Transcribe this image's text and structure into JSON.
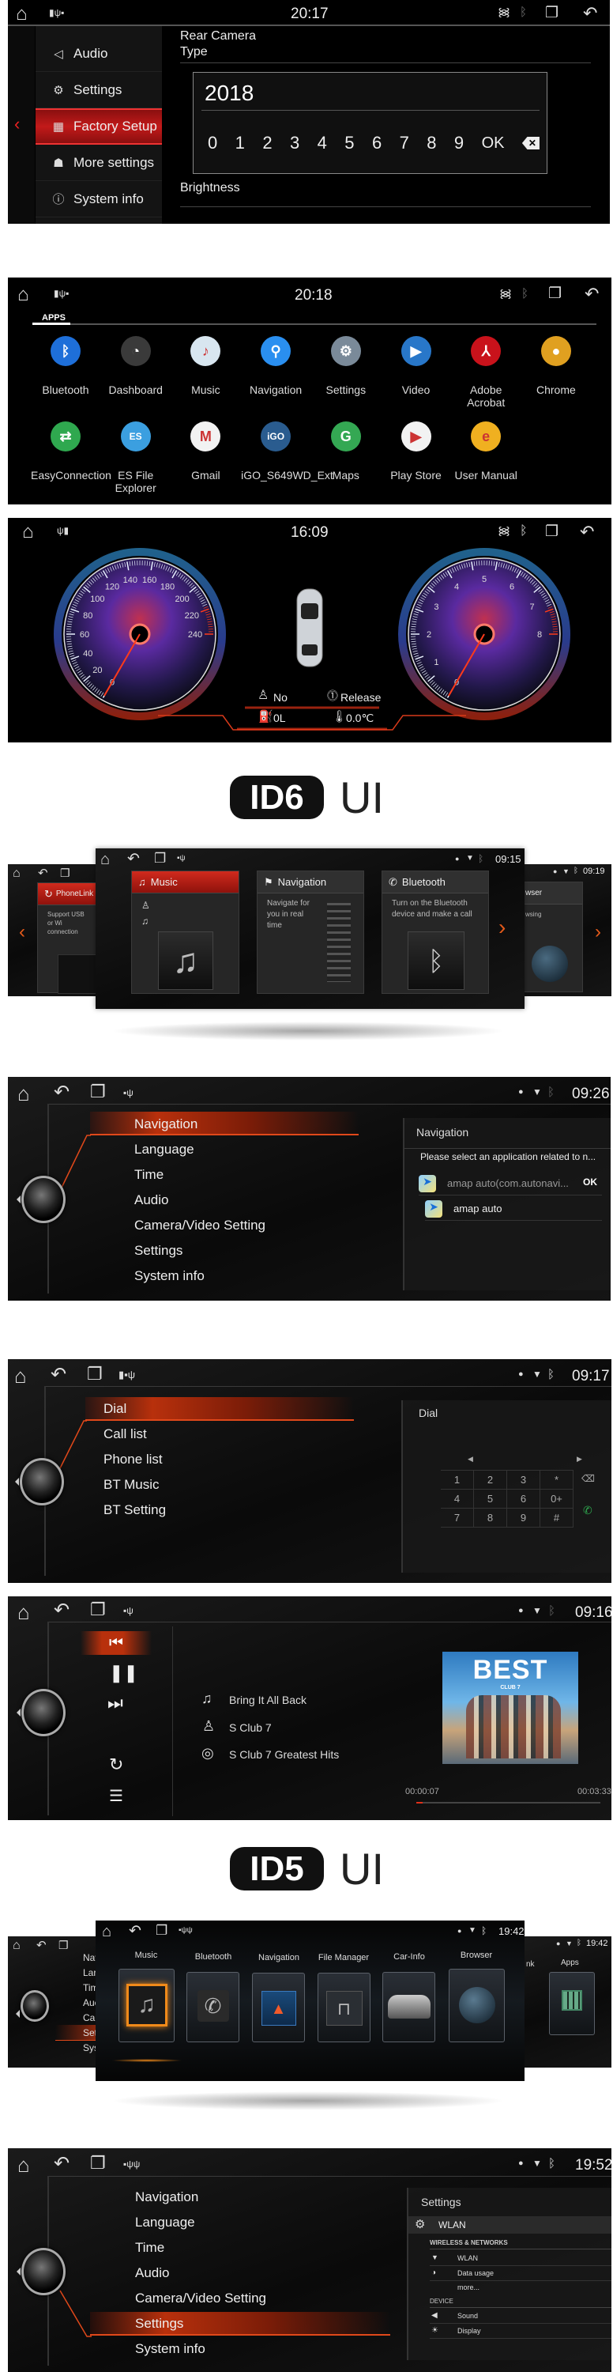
{
  "factory_setup": {
    "status": {
      "time": "20:17"
    },
    "menu": [
      {
        "label": "Audio",
        "icon": "speaker-icon"
      },
      {
        "label": "Settings",
        "icon": "gear-icon"
      },
      {
        "label": "Factory Setup",
        "icon": "factory-icon"
      },
      {
        "label": "More settings",
        "icon": "android-icon"
      },
      {
        "label": "System info",
        "icon": "info-icon"
      }
    ],
    "selected": "Factory Setup",
    "setting_title": "Rear Camera Type",
    "input_value": "2018",
    "keypad": [
      "0",
      "1",
      "2",
      "3",
      "4",
      "5",
      "6",
      "7",
      "8",
      "9",
      "OK"
    ],
    "brightness_label": "Brightness",
    "accent_color": "#c21a1a"
  },
  "apps_screen": {
    "status": {
      "time": "20:18"
    },
    "tab": "APPS",
    "apps": [
      {
        "label": "Bluetooth",
        "icon": "bluetooth-icon",
        "glyph": "ᛒ",
        "color": "#1e6fd9"
      },
      {
        "label": "Dashboard",
        "icon": "dashboard-icon",
        "glyph": "◔",
        "color": "#3a3a3a"
      },
      {
        "label": "Music",
        "icon": "music-icon",
        "glyph": "♪",
        "color": "#d8e6f0"
      },
      {
        "label": "Navigation",
        "icon": "location-pin-icon",
        "glyph": "⚲",
        "color": "#2a8ff0"
      },
      {
        "label": "Settings",
        "icon": "gear-icon",
        "glyph": "⚙",
        "color": "#7a8a99"
      },
      {
        "label": "Video",
        "icon": "clapperboard-icon",
        "glyph": "▶",
        "color": "#2877c9"
      },
      {
        "label": "Adobe Acrobat",
        "icon": "acrobat-icon",
        "glyph": "⅄",
        "color": "#c9121b"
      },
      {
        "label": "Chrome",
        "icon": "chrome-icon",
        "glyph": "●",
        "color": "#e0a020"
      },
      {
        "label": "EasyConnection",
        "icon": "easyconnection-icon",
        "glyph": "⇄",
        "color": "#2fa84f"
      },
      {
        "label": "ES File Explorer",
        "icon": "folder-icon",
        "glyph": "ES",
        "color": "#3b9fe0"
      },
      {
        "label": "Gmail",
        "icon": "gmail-icon",
        "glyph": "M",
        "color": "#f2f2f2"
      },
      {
        "label": "iGO_S649WD_Ext",
        "icon": "igo-icon",
        "glyph": "iGO",
        "color": "#2a5c8f"
      },
      {
        "label": "Maps",
        "icon": "maps-icon",
        "glyph": "G",
        "color": "#34a853"
      },
      {
        "label": "Play Store",
        "icon": "play-store-icon",
        "glyph": "▶",
        "color": "#f2f2f2"
      },
      {
        "label": "User Manual",
        "icon": "manual-icon",
        "glyph": "e",
        "color": "#f0b020"
      }
    ]
  },
  "dashboard": {
    "status": {
      "time": "16:09"
    },
    "speedometer": {
      "ticks": [
        0,
        20,
        40,
        60,
        80,
        100,
        120,
        140,
        160,
        180,
        200,
        220,
        240
      ],
      "value": 0
    },
    "tachometer": {
      "ticks": [
        0,
        1,
        2,
        3,
        4,
        5,
        6,
        7,
        8
      ],
      "value": 0
    },
    "seatbelt": "No",
    "handbrake": "Release",
    "fuel": "0L",
    "temperature": "0.0℃"
  },
  "id6_heading": {
    "badge": "ID6",
    "suffix": "UI"
  },
  "id6_carousel": {
    "front": {
      "time": "09:15",
      "cards": [
        {
          "title": "Music",
          "icon": "music-note-icon"
        },
        {
          "title": "Navigation",
          "icon": "checkered-flag-icon",
          "description": "Navigate for you in real time"
        },
        {
          "title": "Bluetooth",
          "icon": "phone-handset-icon",
          "description": "Turn on the Bluetooth device and make a call"
        }
      ]
    },
    "left": {
      "title": "PhoneLink",
      "description": "Support USB or Wi connection"
    },
    "right": {
      "time": "09:19",
      "title": "wser",
      "description": "wsing"
    }
  },
  "id6_settings": {
    "time": "09:26",
    "menu": [
      "Navigation",
      "Language",
      "Time",
      "Audio",
      "Camera/Video Setting",
      "Settings",
      "System info"
    ],
    "selected": "Navigation",
    "panel": {
      "title": "Navigation",
      "prompt": "Please select an application related to n...",
      "options": [
        {
          "label": "amap auto(com.autonavi...",
          "action": "OK"
        },
        {
          "label": "amap auto"
        }
      ]
    }
  },
  "id6_phone": {
    "time": "09:17",
    "menu": [
      "Dial",
      "Call list",
      "Phone list",
      "BT Music",
      "BT Setting"
    ],
    "selected": "Dial",
    "panel": {
      "title": "Dial",
      "keys": [
        "1",
        "2",
        "3",
        "*",
        "4",
        "5",
        "6",
        "0+",
        "7",
        "8",
        "9",
        "#"
      ]
    }
  },
  "id6_music": {
    "time": "09:16",
    "track": "Bring It All Back",
    "artist": "S Club 7",
    "album": "S Club 7 Greatest Hits",
    "album_art_title": "BEST",
    "album_art_subtitle": "CLUB 7",
    "elapsed": "00:00:07",
    "duration": "00:03:33",
    "progress": 0.033
  },
  "id5_heading": {
    "badge": "ID5",
    "suffix": "UI"
  },
  "id5_carousel": {
    "front": {
      "time": "19:42",
      "tiles": [
        "Music",
        "Bluetooth",
        "Navigation",
        "File Manager",
        "Car-Info",
        "Browser"
      ],
      "selected": "Music"
    },
    "left": {
      "menu": [
        "Nav",
        "Lar",
        "Tim",
        "Auc",
        "Car",
        "Set",
        "Sys"
      ],
      "selected": "Set"
    },
    "right": {
      "time": "19:42",
      "labels": [
        "nk",
        "Apps"
      ]
    }
  },
  "id5_settings": {
    "time": "19:52",
    "menu": [
      "Navigation",
      "Language",
      "Time",
      "Audio",
      "Camera/Video Setting",
      "Settings",
      "System info"
    ],
    "selected": "Settings",
    "panel": {
      "title": "Settings",
      "header_item": "WLAN",
      "wireless_section": "WIRELESS & NETWORKS",
      "wireless_items": [
        "WLAN",
        "Data usage",
        "more..."
      ],
      "device_section": "DEVICE",
      "device_items": [
        "Sound",
        "Display"
      ]
    }
  }
}
